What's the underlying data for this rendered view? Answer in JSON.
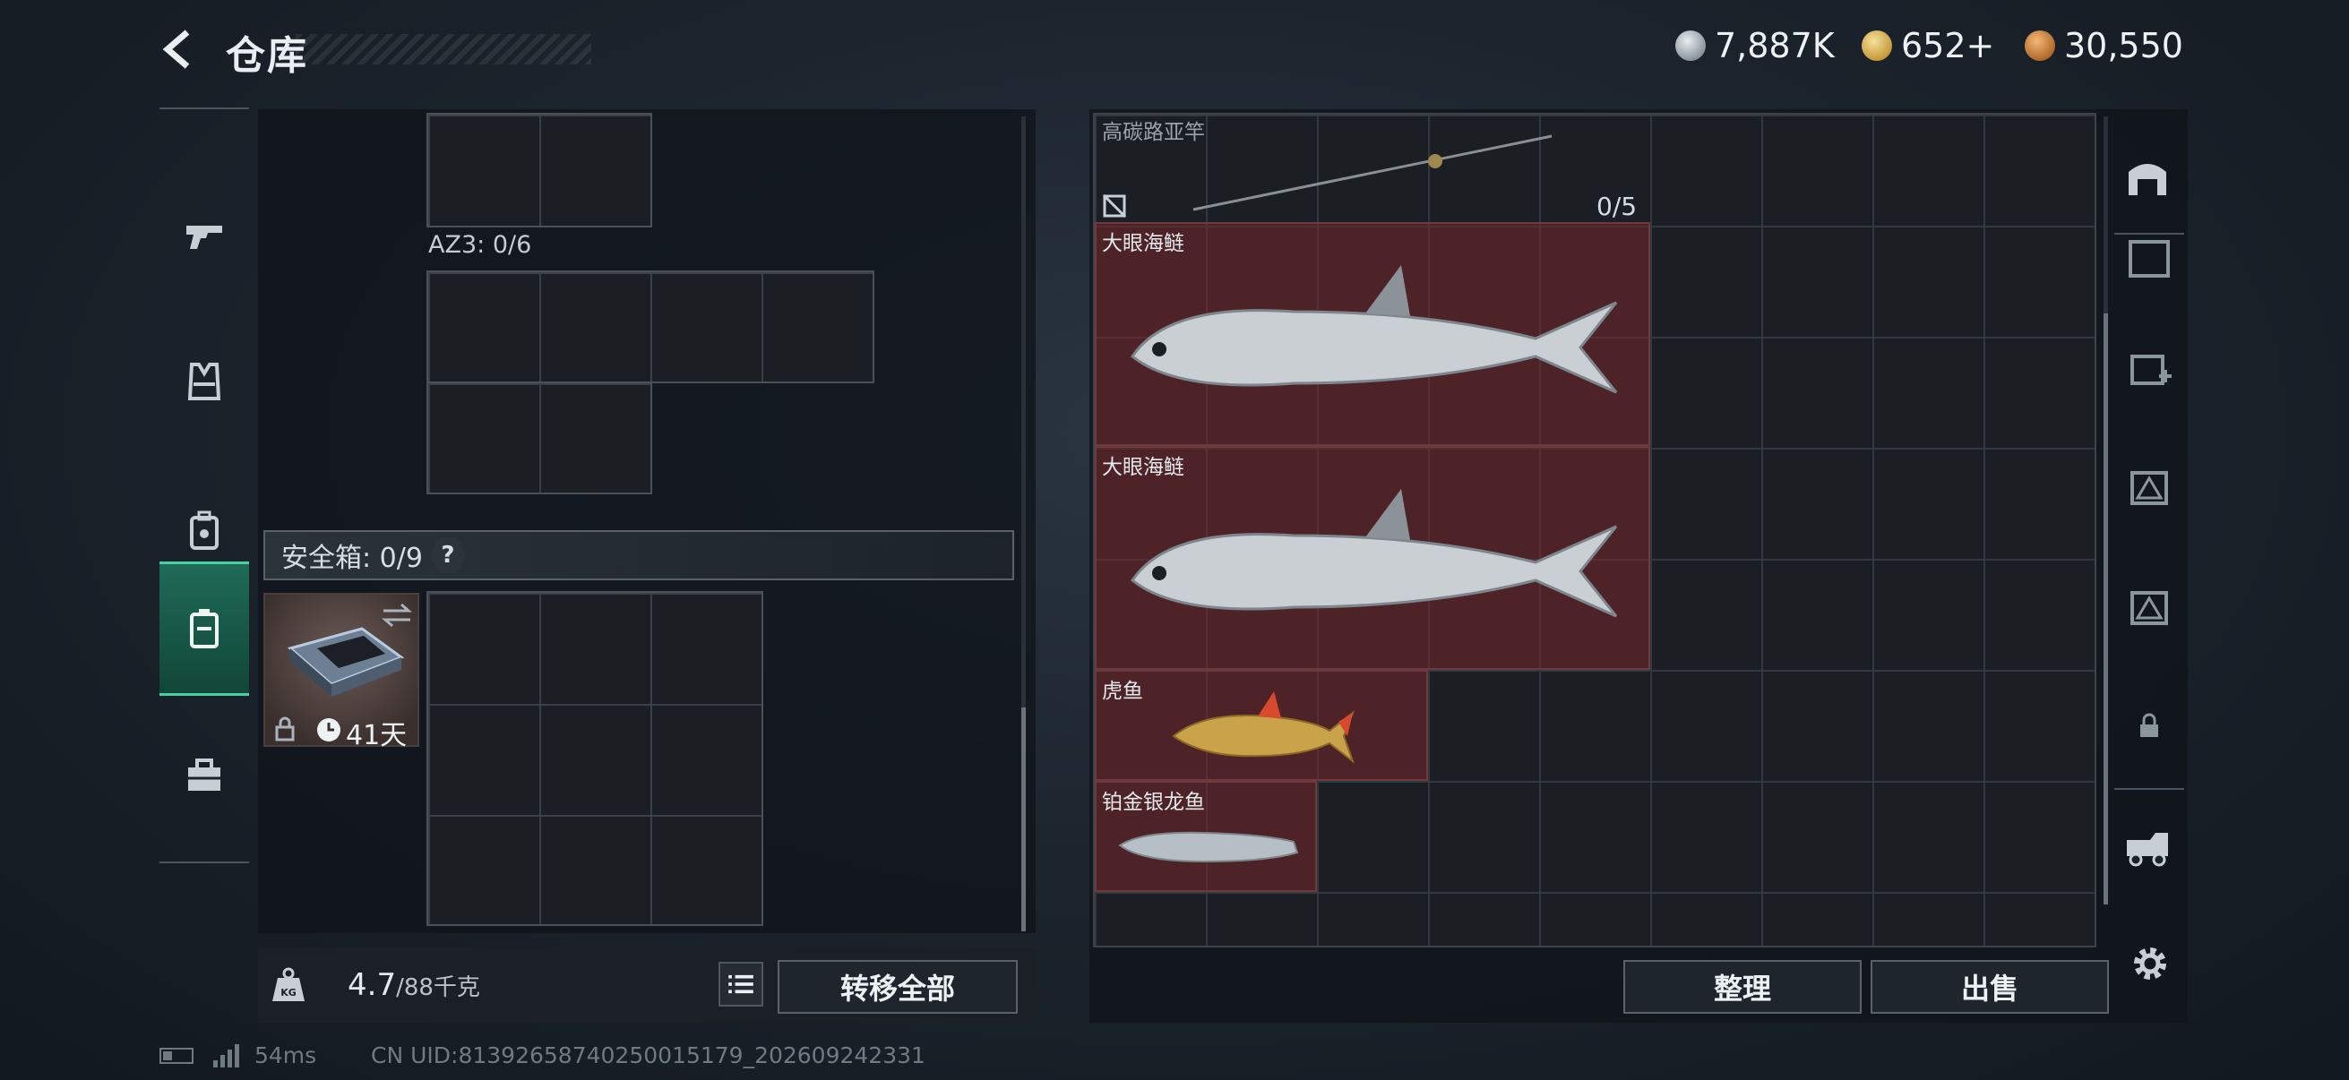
{
  "header": {
    "title": "仓库",
    "currencies": [
      {
        "icon": "silver-coin-icon",
        "value": "7,887K"
      },
      {
        "icon": "gold-coin-icon",
        "value": "652+"
      },
      {
        "icon": "bronze-coin-icon",
        "value": "30,550"
      }
    ]
  },
  "left_nav": [
    {
      "icon": "gun-icon",
      "active": false
    },
    {
      "icon": "vest-icon",
      "active": false
    },
    {
      "icon": "backpack-icon",
      "active": false
    },
    {
      "icon": "case-icon",
      "active": true
    },
    {
      "icon": "toolbox-icon",
      "active": false
    }
  ],
  "left_panel": {
    "az3_label": "AZ3: 0/6",
    "safe_label": "安全箱: 0/9",
    "safe_help": "?",
    "safe_timer": "41天"
  },
  "bottom_left": {
    "weight_current": "4.7",
    "weight_max": "/88千克",
    "transfer_all": "转移全部"
  },
  "stash": {
    "rod_label": "高碳路亚竿",
    "rod_count": "0/5",
    "items": [
      {
        "name": "大眼海鲢"
      },
      {
        "name": "大眼海鲢"
      },
      {
        "name": "虎鱼"
      },
      {
        "name": "铂金银龙鱼"
      }
    ]
  },
  "bottom_right": {
    "sort": "整理",
    "sell": "出售"
  },
  "status_bar": {
    "ping": "54ms",
    "uid": "CN UID:81392658740250015179_202609242331"
  },
  "colors": {
    "accent_active": "#1f6b57",
    "item_bg": "#78262d"
  }
}
